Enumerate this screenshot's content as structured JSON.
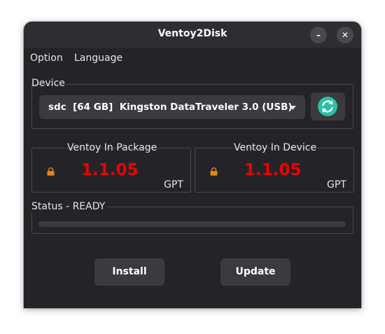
{
  "window": {
    "title": "Ventoy2Disk",
    "minimize_label": "–",
    "close_label": "✕"
  },
  "menu": {
    "items": [
      "Option",
      "Language"
    ]
  },
  "device": {
    "group_label": "Device",
    "selected": "sdc  [64 GB]  Kingston DataTraveler 3.0 (USB)",
    "refresh_icon": "refresh-icon"
  },
  "package": {
    "group_label": "Ventoy In Package",
    "version": "1.1.05",
    "partition_style": "GPT",
    "secure_boot_icon": "lock-icon"
  },
  "device_version": {
    "group_label": "Ventoy In Device",
    "version": "1.1.05",
    "partition_style": "GPT",
    "secure_boot_icon": "lock-icon"
  },
  "status": {
    "label": "Status - READY",
    "progress": 0
  },
  "actions": {
    "install_label": "Install",
    "update_label": "Update"
  },
  "colors": {
    "version_text": "#ee0000",
    "lock_icon": "#e0871a",
    "refresh_icon": "#2dbfa6",
    "window_bg": "#242428"
  }
}
